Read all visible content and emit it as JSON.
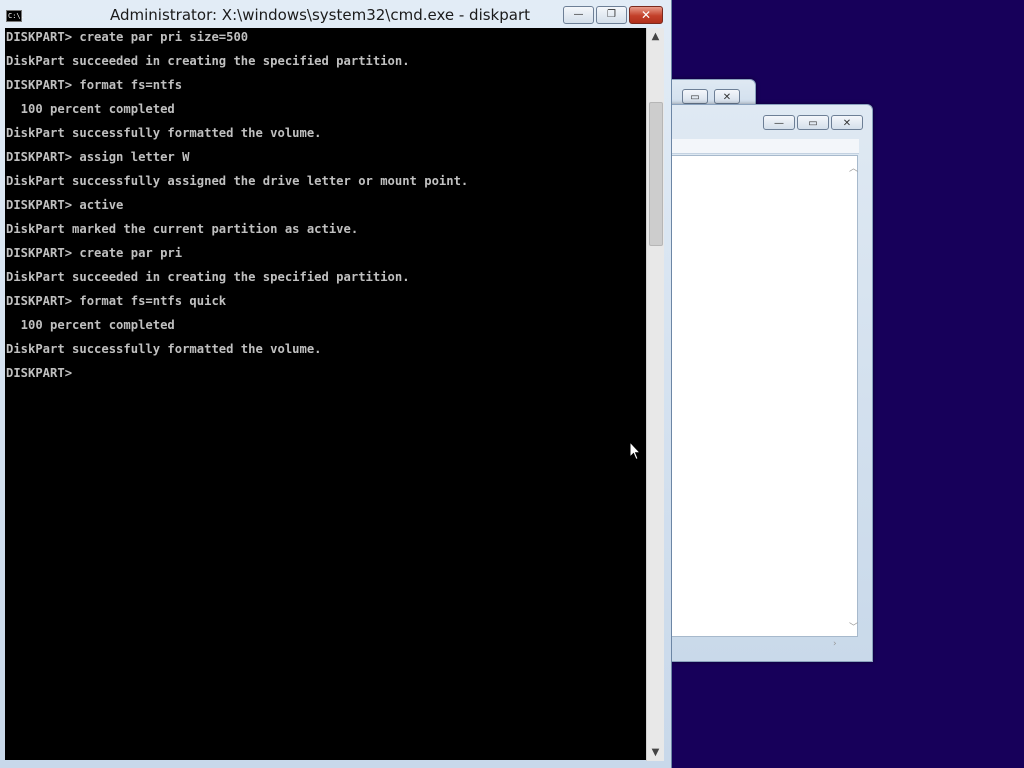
{
  "window": {
    "title": "Administrator: X:\\windows\\system32\\cmd.exe - diskpart",
    "icon_label": "C:\\.",
    "minimize": "—",
    "maximize": "❐",
    "close": "✕"
  },
  "console": {
    "lines": [
      "DISKPART> create par pri size=500",
      "DiskPart succeeded in creating the specified partition.",
      "DISKPART> format fs=ntfs",
      "  100 percent completed",
      "DiskPart successfully formatted the volume.",
      "DISKPART> assign letter W",
      "DiskPart successfully assigned the drive letter or mount point.",
      "DISKPART> active",
      "DiskPart marked the current partition as active.",
      "DISKPART> create par pri",
      "DiskPart succeeded in creating the specified partition.",
      "DISKPART> format fs=ntfs quick",
      "  100 percent completed",
      "DiskPart successfully formatted the volume.",
      "DISKPART> "
    ]
  },
  "scroll": {
    "up": "▲",
    "down": "▼"
  },
  "background_windows": {
    "minimize": "—",
    "maximize": "▭",
    "close": "✕"
  },
  "colors": {
    "desktop": "#17005a",
    "console_bg": "#000000",
    "console_text": "#c0c0c0"
  }
}
